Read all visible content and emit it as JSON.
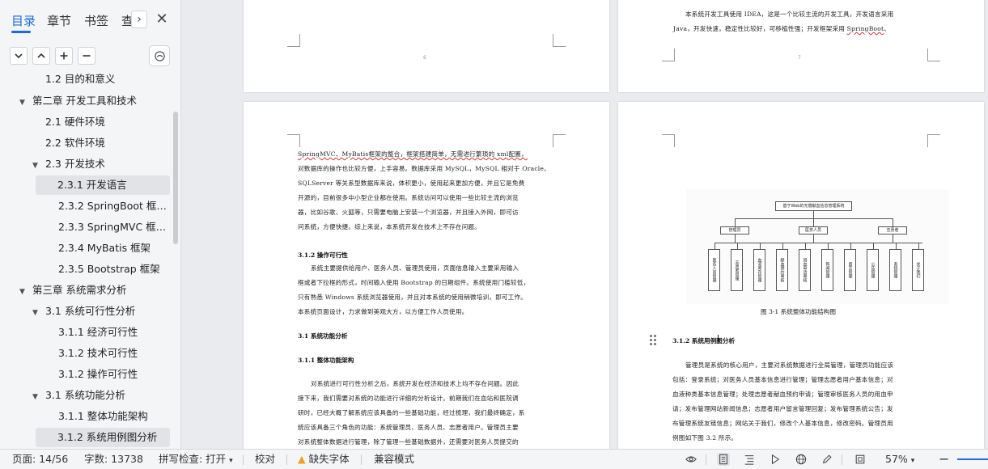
{
  "sidebar": {
    "tabs": [
      "目录",
      "章节",
      "书签",
      "查"
    ],
    "toc": [
      {
        "label": "1.2 目的和意义",
        "level": 2
      },
      {
        "label": "第二章 开发工具和技术",
        "level": 1
      },
      {
        "label": "2.1 硬件环境",
        "level": 2
      },
      {
        "label": "2.2 软件环境",
        "level": 2
      },
      {
        "label": "2.3 开发技术",
        "level": 2
      },
      {
        "label": "2.3.1 开发语言",
        "level": 3
      },
      {
        "label": "2.3.2 SpringBoot 框…",
        "level": 3
      },
      {
        "label": "2.3.3 SpringMVC 框…",
        "level": 3
      },
      {
        "label": "2.3.4 MyBatis 框架",
        "level": 3
      },
      {
        "label": "2.3.5 Bootstrap 框架",
        "level": 3
      },
      {
        "label": "第三章 系统需求分析",
        "level": 1
      },
      {
        "label": "3.1 系统可行性分析",
        "level": 2
      },
      {
        "label": "3.1.1 经济可行性",
        "level": 3
      },
      {
        "label": "3.1.2 技术可行性",
        "level": 3
      },
      {
        "label": "3.1.2 操作可行性",
        "level": 3
      },
      {
        "label": "3.1 系统功能分析",
        "level": 2
      },
      {
        "label": "3.1.1 整体功能架构",
        "level": 3
      },
      {
        "label": "3.1.2 系统用例图分析",
        "level": 3
      }
    ]
  },
  "pages": {
    "p1": {
      "num": "6"
    },
    "p2": {
      "num": "7",
      "line1": "本系统开发工具使用 IDEA，这是一个比较主流的开发工具，开发语言采用",
      "line2a": "Java，开发快速，稳定性比较好，可移植性强；开发框架采用 ",
      "line2b": "SpringBoot",
      "line2c": "、"
    },
    "p3": {
      "para1": [
        "SpringMVC、MyBatis框架的整合，框架搭建简单，无需进行繁琐的 xml配置，",
        "对数据库的操作也比较方便，上手容易。数据库采用 MySQL，MySQL 相对于 Oracle、",
        "SQLServer 等关系型数据库来说，体积更小，使用起来更加方便，并且它是免费",
        "开源的，目前很多中小型企业都在使用。系统访问可以使用一些比较主流的浏览",
        "器，比如谷歌、火狐等，只需要电脑上安装一个浏览器，并且接入外网，即可访",
        "问系统，方便快捷。综上来说，本系统开发在技术上不存在问题。"
      ],
      "h1": "3.1.2 操作可行性",
      "para2": [
        "系统主要提供给用户、医务人员、管理员使用，页面信息输入主要采用输入",
        "框或者下拉框的形式，时间输入使用 Bootstrap 的日期组件。系统使用门槛较低，",
        "只有熟悉 Windows 系统浏览器使用，并且对本系统的使用稍微培训，即可工作。",
        "本系统页面设计，力求做到美观大方，以方便工作人员使用。"
      ],
      "h2": "3.1 系统功能分析",
      "h3": "3.1.1 整体功能架构",
      "para3": [
        "对系统进行可行性分析之后，系统开发在经济和技术上均不存在问题。因此",
        "接下来，我们需要对系统的功能进行详细的分析设计。前期我们在血站和医院调",
        "研时，已经大概了解系统应该具备的一些基础功能，经过梳理，我们最终确定，系",
        "统应该具备三个角色的功能：系统管理员、医务人员、志愿者用户。管理员主要",
        "对系统整体数据进行管理，除了管理一些基础数据外，还需要对医务人员提交的"
      ]
    },
    "p4": {
      "diagram_root": "基于Web的无偿献血信息管理系统",
      "roles": [
        "管理员",
        "医务人员",
        "志愿者"
      ],
      "modules": [
        "医务人员管理",
        "志愿者管理",
        "血液库存管理",
        "献血预约审核",
        "用血申请审核",
        "新闻管理",
        "留言管理",
        "公告管理",
        "系统管理",
        "关于我们"
      ],
      "caption": "图 3-1 系统整体功能结构图",
      "heading": "3.1.2 系统用例图分析",
      "para": [
        "管理员是系统的核心用户，主要对系统数据进行全局管理，管理员功能应该",
        "包括：登录系统；对医务人员基本信息进行管理；管理志愿者用户基本信息；对",
        "血液种类基本信息管理；处理志愿者献血预约申请；管理审核医务人员的用血申",
        "请；发布管理网站新闻信息；志愿者用户留言管理回复；发布管理系统公告；发",
        "布管理系统友链信息；网站关于我们，修改个人基本信息，修改密码。管理员用",
        "例图如下图 3.2 所示。"
      ]
    }
  },
  "statusbar": {
    "page": "页面: 14/56",
    "words": "字数: 13738",
    "spell": "拼写检查: 打开",
    "proof": "校对",
    "font_missing": "缺失字体",
    "compat": "兼容模式",
    "zoom": "57%"
  },
  "colors": {
    "accent": "#1c6cdc",
    "warning": "#f0a020"
  }
}
